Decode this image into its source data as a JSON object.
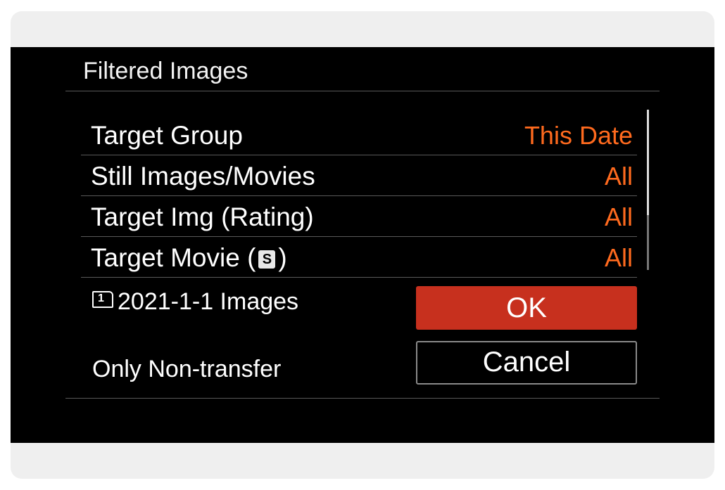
{
  "menu": {
    "title": "Filtered Images",
    "rows": [
      {
        "label": "Target Group",
        "value": "This Date"
      },
      {
        "label": "Still Images/Movies",
        "value": "All"
      },
      {
        "label": "Target Img (Rating)",
        "value": "All"
      },
      {
        "label_prefix": "Target Movie (",
        "label_suffix": ")",
        "glyph": "S",
        "value": "All"
      }
    ],
    "summary": {
      "card_slot": "1",
      "text": "2021-1-1 Images",
      "note": "Only Non-transfer"
    },
    "buttons": {
      "ok": "OK",
      "cancel": "Cancel"
    }
  },
  "colors": {
    "background": "#000000",
    "value_accent": "#ff6a1e",
    "ok_button": "#c7301e",
    "frame": "#efefef"
  },
  "icons": {
    "card_slot": "memory-card-slot-icon",
    "movie_format": "s-format-icon"
  }
}
